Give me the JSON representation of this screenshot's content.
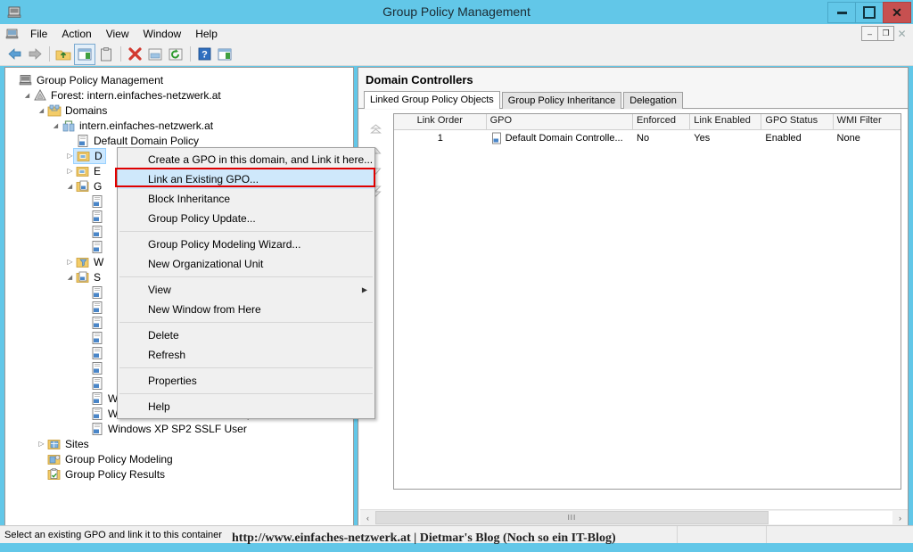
{
  "window": {
    "title": "Group Policy Management",
    "icon": "console-icon",
    "buttons": {
      "minimize": "–",
      "maximize": "□",
      "close": "✕"
    }
  },
  "menubar": {
    "items": [
      "File",
      "Action",
      "View",
      "Window",
      "Help"
    ],
    "mdi_buttons": {
      "minimize": "–",
      "restore": "❐",
      "close": "✕"
    }
  },
  "toolbar": {
    "buttons": [
      {
        "name": "back-icon",
        "glyph": "⬅"
      },
      {
        "name": "forward-icon",
        "glyph": "➡"
      },
      {
        "name": "up-folder-icon",
        "glyph": "folder"
      },
      {
        "name": "show-hide-console-tree-icon",
        "glyph": "window"
      },
      {
        "name": "copy-icon",
        "glyph": "clipboard"
      },
      {
        "name": "delete-icon",
        "glyph": "✖"
      },
      {
        "name": "properties-icon",
        "glyph": "props"
      },
      {
        "name": "refresh-icon",
        "glyph": "↻"
      },
      {
        "name": "help-icon",
        "glyph": "?"
      },
      {
        "name": "export-list-icon",
        "glyph": "list"
      }
    ]
  },
  "tree": {
    "nodes": [
      {
        "label": "Group Policy Management",
        "indent": 0,
        "twist": "none",
        "icon": "console-icon",
        "selected": false
      },
      {
        "label": "Forest: intern.einfaches-netzwerk.at",
        "indent": 1,
        "twist": "expanded",
        "icon": "forest-icon",
        "selected": false
      },
      {
        "label": "Domains",
        "indent": 2,
        "twist": "expanded",
        "icon": "domains-icon",
        "selected": false
      },
      {
        "label": "intern.einfaches-netzwerk.at",
        "indent": 3,
        "twist": "expanded",
        "icon": "domain-icon",
        "selected": false
      },
      {
        "label": "Default Domain Policy",
        "indent": 4,
        "twist": "none",
        "icon": "gpo-icon",
        "selected": false
      },
      {
        "label": "D",
        "indent": 4,
        "twist": "collapsed",
        "icon": "ou-icon",
        "selected": true
      },
      {
        "label": "E",
        "indent": 4,
        "twist": "collapsed",
        "icon": "ou-icon",
        "selected": false
      },
      {
        "label": "G",
        "indent": 4,
        "twist": "expanded",
        "icon": "gpo-container-icon",
        "selected": false
      },
      {
        "label": "",
        "indent": 5,
        "twist": "none",
        "icon": "gpo-icon",
        "selected": false
      },
      {
        "label": "",
        "indent": 5,
        "twist": "none",
        "icon": "gpo-icon",
        "selected": false
      },
      {
        "label": "",
        "indent": 5,
        "twist": "none",
        "icon": "gpo-icon",
        "selected": false
      },
      {
        "label": "",
        "indent": 5,
        "twist": "none",
        "icon": "gpo-icon",
        "selected": false
      },
      {
        "label": "W",
        "indent": 4,
        "twist": "collapsed",
        "icon": "wmi-filters-icon",
        "selected": false
      },
      {
        "label": "S",
        "indent": 4,
        "twist": "expanded",
        "icon": "starter-gpos-icon",
        "selected": false
      },
      {
        "label": "",
        "indent": 5,
        "twist": "none",
        "icon": "gpo-icon",
        "selected": false
      },
      {
        "label": "",
        "indent": 5,
        "twist": "none",
        "icon": "gpo-icon",
        "selected": false
      },
      {
        "label": "",
        "indent": 5,
        "twist": "none",
        "icon": "gpo-icon",
        "selected": false
      },
      {
        "label": "",
        "indent": 5,
        "twist": "none",
        "icon": "gpo-icon",
        "selected": false
      },
      {
        "label": "",
        "indent": 5,
        "twist": "none",
        "icon": "gpo-icon",
        "selected": false
      },
      {
        "label": "",
        "indent": 5,
        "twist": "none",
        "icon": "gpo-icon",
        "selected": false
      },
      {
        "label": "",
        "indent": 5,
        "twist": "none",
        "icon": "gpo-icon",
        "selected": false
      },
      {
        "label": "Windows XP SP2 EC User",
        "indent": 5,
        "twist": "none",
        "icon": "gpo-icon",
        "selected": false
      },
      {
        "label": "Windows XP SP2 SSLF Computer",
        "indent": 5,
        "twist": "none",
        "icon": "gpo-icon",
        "selected": false
      },
      {
        "label": "Windows XP SP2 SSLF User",
        "indent": 5,
        "twist": "none",
        "icon": "gpo-icon",
        "selected": false
      },
      {
        "label": "Sites",
        "indent": 2,
        "twist": "collapsed",
        "icon": "sites-icon",
        "selected": false
      },
      {
        "label": "Group Policy Modeling",
        "indent": 2,
        "twist": "none",
        "icon": "modeling-icon",
        "selected": false
      },
      {
        "label": "Group Policy Results",
        "indent": 2,
        "twist": "none",
        "icon": "results-icon",
        "selected": false
      }
    ]
  },
  "context_menu": {
    "items": [
      {
        "label": "Create a GPO in this domain, and Link it here...",
        "highlight": false,
        "submenu": false
      },
      {
        "label": "Link an Existing GPO...",
        "highlight": true,
        "submenu": false
      },
      {
        "label": "Block Inheritance",
        "highlight": false,
        "submenu": false
      },
      {
        "label": "Group Policy Update...",
        "highlight": false,
        "submenu": false
      },
      {
        "separator": true
      },
      {
        "label": "Group Policy Modeling Wizard...",
        "highlight": false,
        "submenu": false
      },
      {
        "label": "New Organizational Unit",
        "highlight": false,
        "submenu": false
      },
      {
        "separator": true
      },
      {
        "label": "View",
        "highlight": false,
        "submenu": true
      },
      {
        "label": "New Window from Here",
        "highlight": false,
        "submenu": false
      },
      {
        "separator": true
      },
      {
        "label": "Delete",
        "highlight": false,
        "submenu": false
      },
      {
        "label": "Refresh",
        "highlight": false,
        "submenu": false
      },
      {
        "separator": true
      },
      {
        "label": "Properties",
        "highlight": false,
        "submenu": false
      },
      {
        "separator": true
      },
      {
        "label": "Help",
        "highlight": false,
        "submenu": false
      }
    ],
    "highlight_color": "#e00000",
    "submenu_arrow": "▶"
  },
  "right_pane": {
    "title": "Domain Controllers",
    "tabs": [
      {
        "label": "Linked Group Policy Objects",
        "active": true
      },
      {
        "label": "Group Policy Inheritance",
        "active": false
      },
      {
        "label": "Delegation",
        "active": false
      }
    ],
    "order_buttons": [
      {
        "name": "move-to-top-button",
        "glyph": "⏫"
      },
      {
        "name": "move-up-button",
        "glyph": "▲"
      },
      {
        "name": "move-down-button",
        "glyph": "▼"
      },
      {
        "name": "move-to-bottom-button",
        "glyph": "⏬"
      }
    ],
    "grid": {
      "columns": [
        "Link Order",
        "GPO",
        "Enforced",
        "Link Enabled",
        "GPO Status",
        "WMI Filter"
      ],
      "rows": [
        {
          "link_order": "1",
          "gpo": "Default Domain Controlle...",
          "enforced": "No",
          "link_enabled": "Yes",
          "gpo_status": "Enabled",
          "wmi_filter": "None"
        }
      ]
    },
    "scrollbar": {
      "left_arrow": "‹",
      "right_arrow": "›",
      "thumb_grip": "III"
    }
  },
  "statusbar": {
    "message": "Select an existing GPO and link it to this container",
    "watermark": "http://www.einfaches-netzwerk.at | Dietmar's Blog (Noch so ein IT-Blog)"
  },
  "colors": {
    "titlebar": "#62c7e8",
    "close_button": "#c75050",
    "selection": "#cce8ff",
    "menu_highlight": "#cfe8fb",
    "red_box": "#e00000"
  }
}
